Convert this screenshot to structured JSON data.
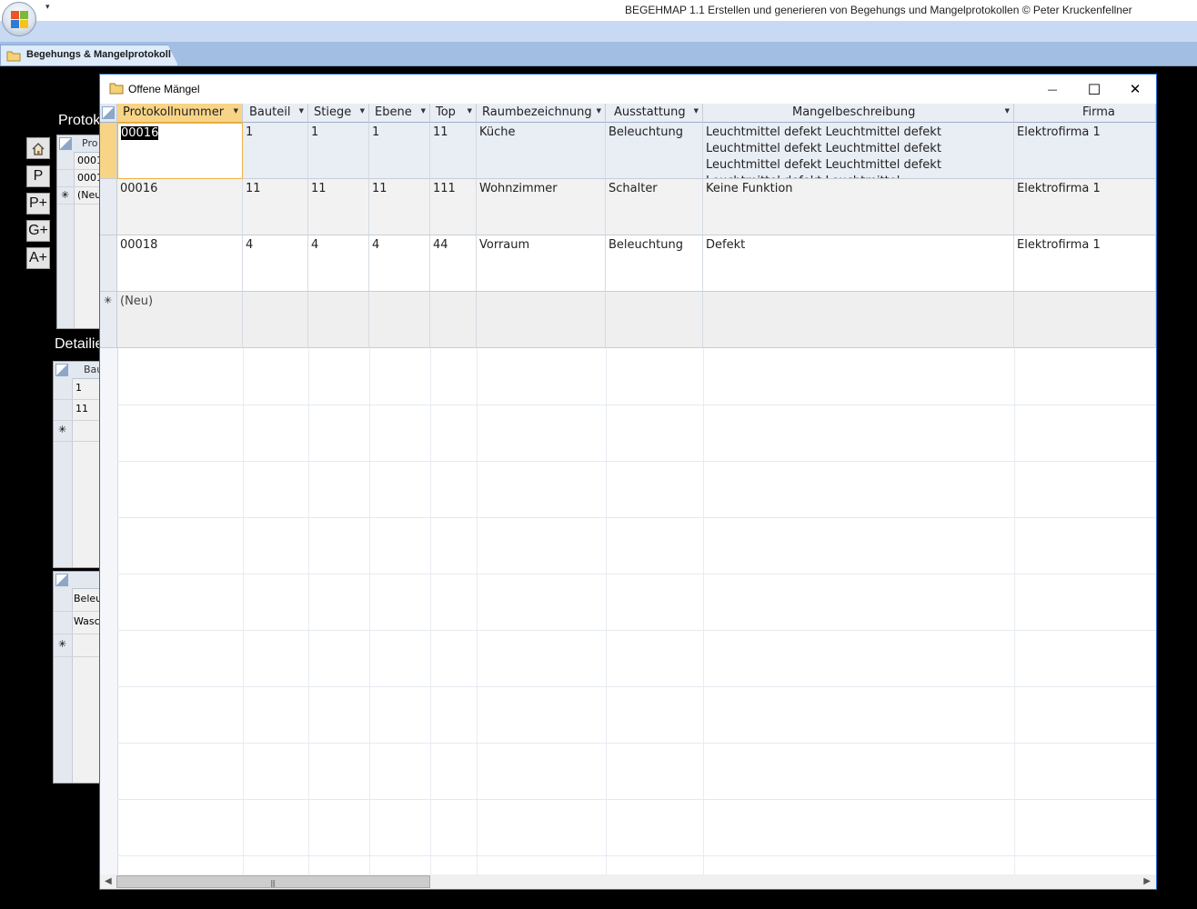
{
  "app": {
    "title": "BEGEHMAP 1.1 Erstellen und generieren von Begehungs und Mangelprotokollen © Peter Kruckenfellner",
    "qat_arrow": "▾"
  },
  "document_tab": {
    "label": "Begehungs & Mangelprotokoll"
  },
  "background_form": {
    "section1_label": "Protok",
    "section2_label": "Detailie",
    "nav_buttons": [
      "P",
      "P+",
      "G+",
      "A+"
    ],
    "protokoll_grid": {
      "header": "Pro",
      "rows": [
        "0001",
        "0001"
      ],
      "new_row": "(Neu"
    },
    "detail_grid": {
      "header": "Bau",
      "rows": [
        "1",
        "11"
      ]
    },
    "ausstattung_grid": {
      "rows": [
        "Beleu",
        "Wasc"
      ]
    }
  },
  "window": {
    "title": "Offene Mängel",
    "minimize_glyph": "—",
    "maximize_glyph": "☐",
    "close_glyph": "✕"
  },
  "table": {
    "columns": [
      "Protokollnummer",
      "Bauteil",
      "Stiege",
      "Ebene",
      "Top",
      "Raumbezeichnung",
      "Ausstattung",
      "Mangelbeschreibung",
      "Firma"
    ],
    "rows": [
      [
        "00016",
        "1",
        "1",
        "1",
        "11",
        "Küche",
        "Beleuchtung",
        "Leuchtmittel defekt Leuchtmittel defekt Leuchtmittel defekt Leuchtmittel defekt Leuchtmittel defekt Leuchtmittel defekt Leuchtmittel defekt Leuchtmittel",
        "Elektrofirma 1"
      ],
      [
        "00016",
        "11",
        "11",
        "11",
        "111",
        "Wohnzimmer",
        "Schalter",
        "Keine Funktion",
        "Elektrofirma 1"
      ],
      [
        "00018",
        "4",
        "4",
        "4",
        "44",
        "Vorraum",
        "Beleuchtung",
        "Defekt",
        "Elektrofirma 1"
      ]
    ],
    "new_row_label": "(Neu)",
    "active_column": "Protokollnummer"
  }
}
